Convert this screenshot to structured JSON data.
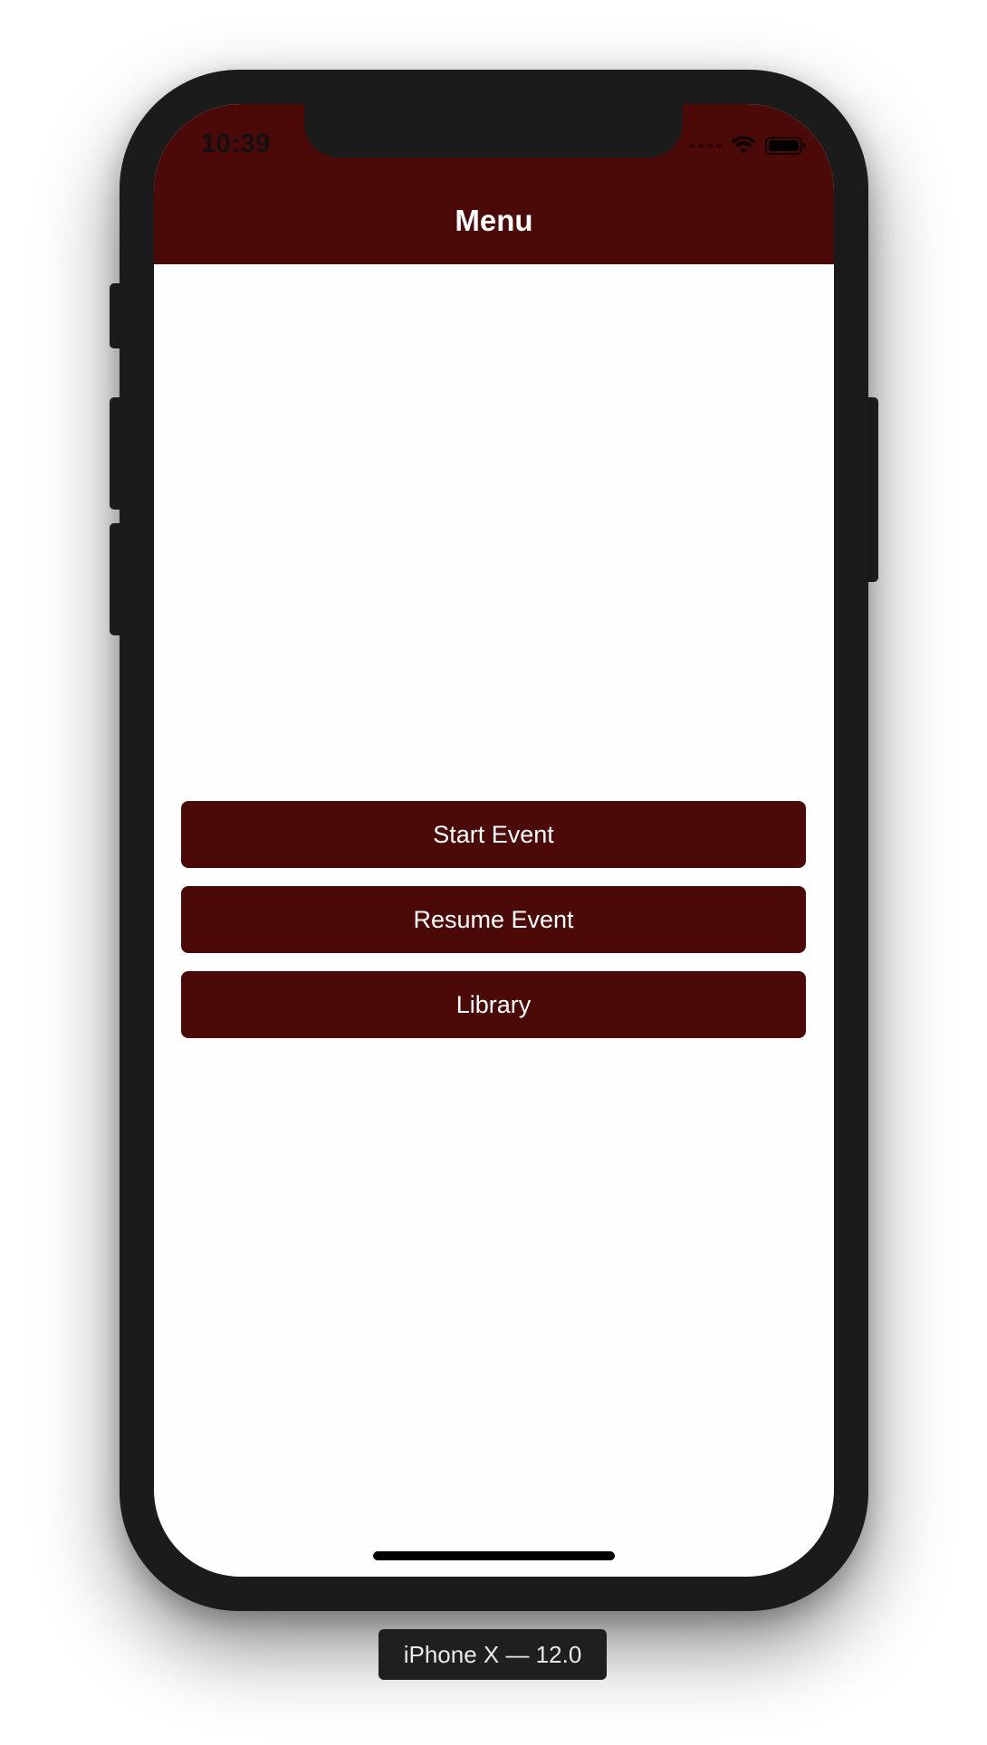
{
  "status_bar": {
    "time": "10:39",
    "wifi_icon": "wifi-icon",
    "battery_icon": "battery-icon"
  },
  "nav": {
    "title": "Menu"
  },
  "menu": {
    "buttons": [
      {
        "label": "Start Event"
      },
      {
        "label": "Resume Event"
      },
      {
        "label": "Library"
      }
    ]
  },
  "simulator": {
    "device_label": "iPhone X — 12.0"
  },
  "colors": {
    "accent": "#4b0a08",
    "frame": "#1b1b1b"
  }
}
